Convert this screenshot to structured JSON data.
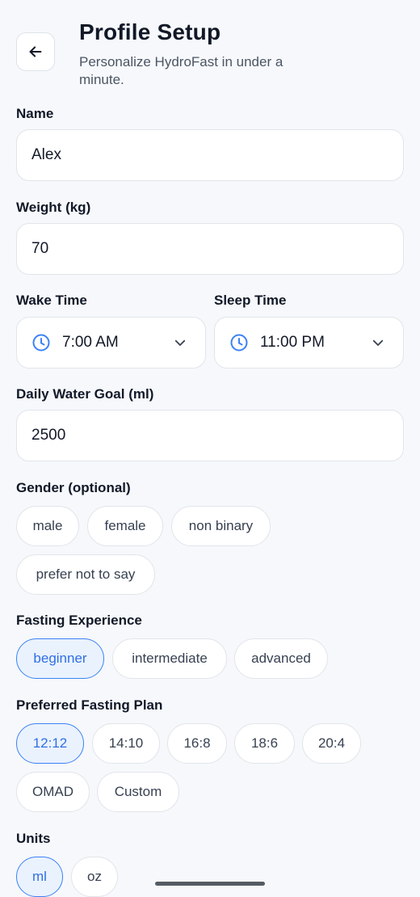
{
  "header": {
    "title": "Profile Setup",
    "subtitle": "Personalize HydroFast in under a minute."
  },
  "fields": {
    "name": {
      "label": "Name",
      "value": "Alex"
    },
    "weight": {
      "label": "Weight (kg)",
      "value": "70"
    },
    "wake_time": {
      "label": "Wake Time",
      "value": "7:00 AM"
    },
    "sleep_time": {
      "label": "Sleep Time",
      "value": "11:00 PM"
    },
    "water_goal": {
      "label": "Daily Water Goal (ml)",
      "value": "2500"
    }
  },
  "gender": {
    "label": "Gender (optional)",
    "options": [
      "male",
      "female",
      "non binary",
      "prefer not to say"
    ]
  },
  "fasting_experience": {
    "label": "Fasting Experience",
    "options": [
      "beginner",
      "intermediate",
      "advanced"
    ],
    "selected": "beginner"
  },
  "fasting_plan": {
    "label": "Preferred Fasting Plan",
    "options": [
      "12:12",
      "14:10",
      "16:8",
      "18:6",
      "20:4",
      "OMAD",
      "Custom"
    ],
    "selected": "12:12"
  },
  "units": {
    "label": "Units",
    "options": [
      "ml",
      "oz"
    ],
    "selected": "ml"
  },
  "colors": {
    "accent": "#3b82f6",
    "background": "#f6f8fb"
  },
  "icons": {
    "back": "arrow-left-icon",
    "time": "clock-icon",
    "dropdown": "chevron-down-icon"
  }
}
